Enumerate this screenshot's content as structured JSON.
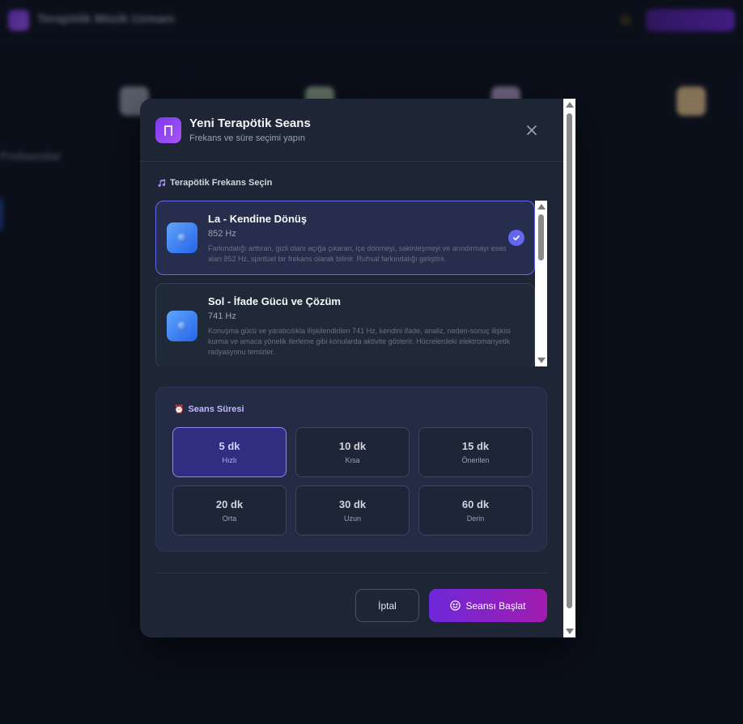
{
  "background": {
    "app_title": "Terapötik Müzik Uzmanı",
    "section_title": "Frekanslar"
  },
  "modal": {
    "title": "Yeni Terapötik Seans",
    "subtitle": "Frekans ve süre seçimi yapın",
    "close_icon": "close-icon",
    "frequency_section_label": "Terapötik Frekans Seçin",
    "frequencies": [
      {
        "name": "La - Kendine Dönüş",
        "hz": "852 Hz",
        "description": "Farkındalığı arttıran, gizli olanı açığa çıkaran, içe dönmeyi, sakinleşmeyi ve arındırmayı esas alan 852 Hz, spiritüel bir frekans olarak bilinir. Ruhsal farkındalığı geliştirir.",
        "selected": true
      },
      {
        "name": "Sol - İfade Gücü ve Çözüm",
        "hz": "741 Hz",
        "description": "Konuşma gücü ve yaratıcılıkla ilişkilendirilen 741 Hz, kendini ifade, analiz, neden-sonuç ilişkisi kurma ve amaca yönelik ilerleme gibi konularda aktivite gösterir. Hücrelerdeki elektromanyetik radyasyonu temizler.",
        "selected": false
      }
    ],
    "duration_section_label": "Seans Süresi",
    "durations": [
      {
        "value": "5 dk",
        "label": "Hızlı",
        "selected": true
      },
      {
        "value": "10 dk",
        "label": "Kısa",
        "selected": false
      },
      {
        "value": "15 dk",
        "label": "Önerilen",
        "selected": false
      },
      {
        "value": "20 dk",
        "label": "Orta",
        "selected": false
      },
      {
        "value": "30 dk",
        "label": "Uzun",
        "selected": false
      },
      {
        "value": "60 dk",
        "label": "Derin",
        "selected": false
      }
    ],
    "cancel_label": "İptal",
    "start_label": "Seansı Başlat"
  },
  "colors": {
    "accent": "#6366f1",
    "primary_gradient_start": "#6d28d9",
    "primary_gradient_end": "#a21caf"
  }
}
